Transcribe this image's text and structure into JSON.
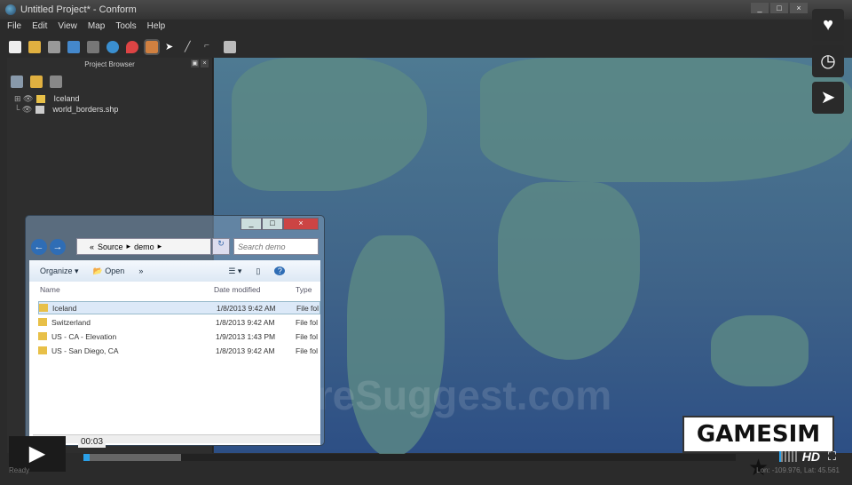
{
  "window": {
    "title": "Untitled Project* - Conform",
    "min": "_",
    "max": "□",
    "close": "×"
  },
  "menu": [
    "File",
    "Edit",
    "View",
    "Map",
    "Tools",
    "Help"
  ],
  "project_browser": {
    "title": "Project Browser",
    "items": [
      "Iceland",
      "world_borders.shp"
    ]
  },
  "explorer": {
    "breadcrumb": [
      "Source",
      "demo"
    ],
    "search_placeholder": "Search demo",
    "organize": "Organize",
    "open": "Open",
    "more": "»",
    "columns": [
      "Name",
      "Date modified",
      "Type"
    ],
    "rows": [
      {
        "name": "Iceland",
        "date": "1/8/2013 9:42 AM",
        "type": "File fol"
      },
      {
        "name": "Switzerland",
        "date": "1/8/2013 9:42 AM",
        "type": "File fol"
      },
      {
        "name": "US - CA - Elevation",
        "date": "1/9/2013 1:43 PM",
        "type": "File fol"
      },
      {
        "name": "US - San Diego, CA",
        "date": "1/8/2013 9:42 AM",
        "type": "File fol"
      }
    ]
  },
  "player": {
    "time": "00:03",
    "hd": "HD",
    "progress_percent": 1,
    "buffered_percent": 15
  },
  "logo": "GAMESIM ★",
  "watermark": "SoftwareSuggest.com",
  "status": {
    "text": "Ready",
    "coords": "Lon: -109.976, Lat: 45.561"
  }
}
